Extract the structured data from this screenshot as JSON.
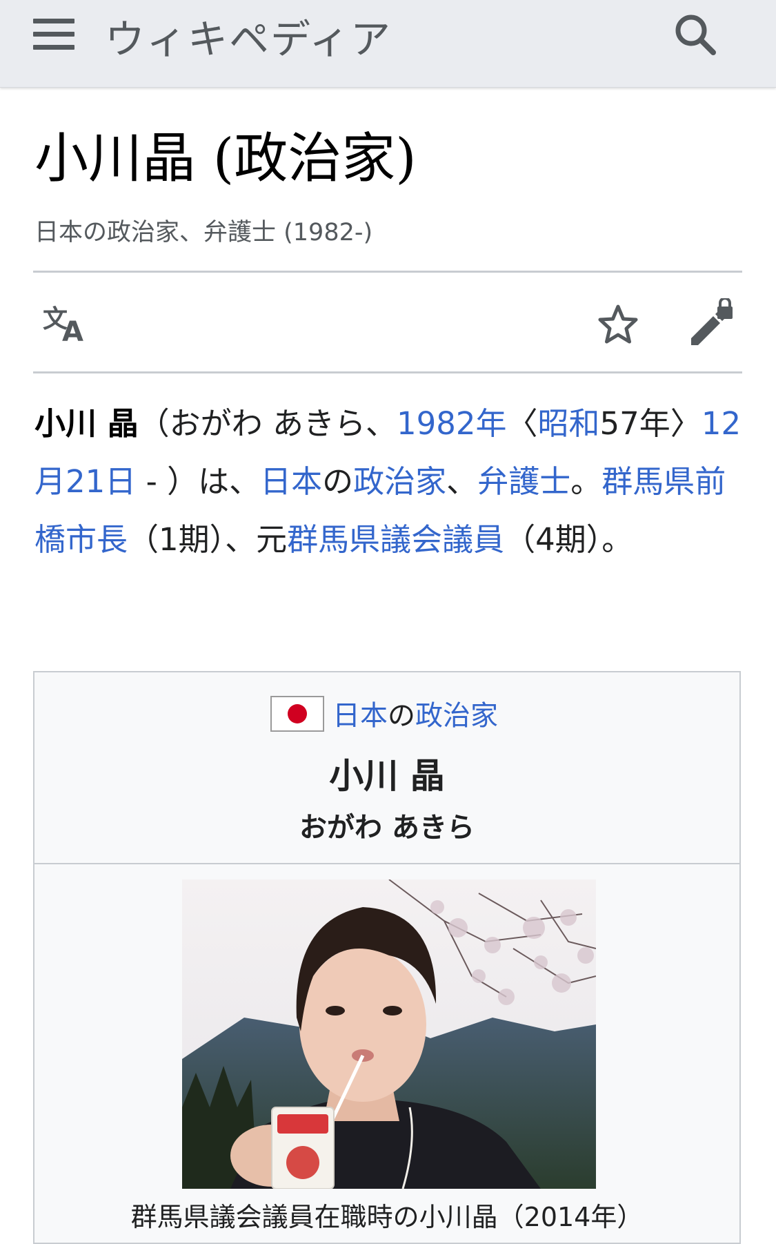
{
  "header": {
    "logo": "ウィキペディア"
  },
  "article": {
    "title": "小川晶 (政治家)",
    "subtitle": "日本の政治家、弁護士 (1982-)"
  },
  "intro": {
    "name": "小川 晶",
    "p1": "（おがわ あきら、",
    "link_1982": "1982年",
    "p2": "〈",
    "link_showa": "昭和",
    "p3": "57年〉",
    "link_date": "12月21日",
    "p4": " - ）は、",
    "link_japan": "日本",
    "p5": "の",
    "link_politician": "政治家",
    "p6": "、",
    "link_lawyer": "弁護士",
    "p7": "。",
    "link_mayor": "群馬県前橋市長",
    "p8": "（1期）、元",
    "link_assembly": "群馬県議会議員",
    "p9": "（4期）。"
  },
  "infobox": {
    "category_link_1": "日本",
    "category_mid": "の",
    "category_link_2": "政治家",
    "name": "小川 晶",
    "reading": "おがわ あきら",
    "caption": "群馬県議会議員在職時の小川晶（2014年）"
  },
  "icons": {
    "menu": "menu-icon",
    "search": "search-icon",
    "translate": "translate-icon",
    "watch": "star-icon",
    "edit": "edit-lock-icon"
  },
  "colors": {
    "link": "#3366cc",
    "header_bg": "#eaecf0",
    "flag_red": "#d00020"
  }
}
